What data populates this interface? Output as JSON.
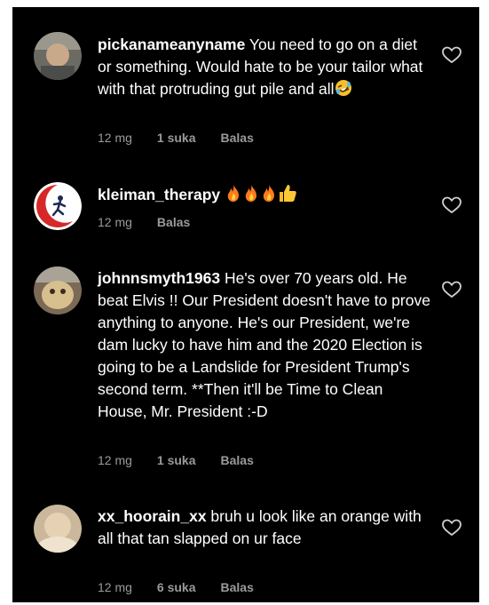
{
  "comments": [
    {
      "username": "pickanameanyname",
      "text": " You need to go on a diet or something. Would hate to be your tailor what with that protruding gut pile and all",
      "emoji": "rofl-emoji",
      "time": "12 mg",
      "likes": "1 suka",
      "reply": "Balas"
    },
    {
      "username": "kleiman_therapy",
      "text": "",
      "emoji": "fire-fire-fire-thumbs-up",
      "time": "12 mg",
      "reply": "Balas"
    },
    {
      "username": "johnnsmyth1963",
      "text": " He's over 70 years old. He beat Elvis !! Our President doesn't have to prove anything to anyone. He's our President, we're dam lucky to have him and the 2020 Election is going to be a Landslide for President Trump's second term. **Then it'll be Time to Clean House, Mr. President :-D",
      "time": "12 mg",
      "likes": "1 suka",
      "reply": "Balas"
    },
    {
      "username": "xx_hoorain_xx",
      "text": " bruh u look like an orange with all that tan slapped on ur face",
      "time": "12 mg",
      "likes": "6 suka",
      "reply": "Balas"
    }
  ],
  "colors": {
    "background": "#000000",
    "text": "#ffffff",
    "meta": "#9a9a9a"
  }
}
